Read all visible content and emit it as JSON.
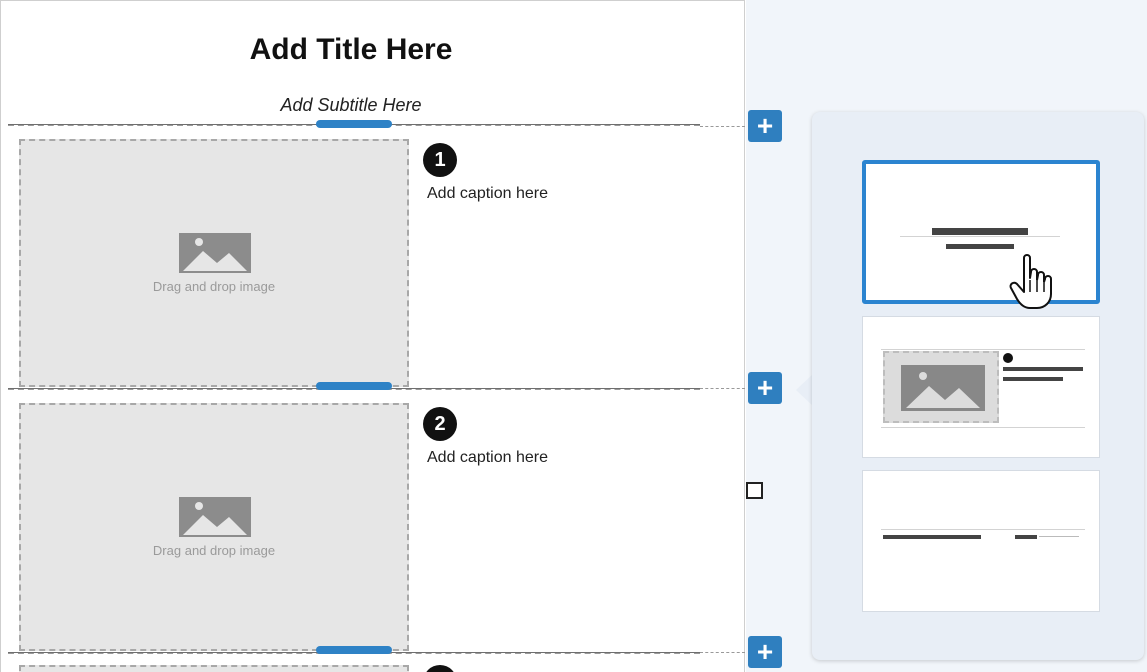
{
  "document": {
    "title": "Add Title Here",
    "subtitle": "Add Subtitle Here",
    "steps": [
      {
        "number": "1",
        "caption": "Add caption here",
        "image_placeholder": "Drag and drop image"
      },
      {
        "number": "2",
        "caption": "Add caption here",
        "image_placeholder": "Drag and drop image"
      }
    ]
  },
  "layout_picker": {
    "options": [
      {
        "name": "title-layout",
        "selected": true
      },
      {
        "name": "image-and-caption-layout",
        "selected": false
      },
      {
        "name": "text-row-layout",
        "selected": false
      }
    ]
  },
  "icons": {
    "add": "plus-icon",
    "image": "image-placeholder-icon",
    "cursor": "hand-pointer-icon"
  },
  "colors": {
    "accent": "#2f7fbf",
    "selected_border": "#2b84d0",
    "placeholder_bg": "#e6e6e6",
    "popup_bg": "#e8eef6"
  }
}
